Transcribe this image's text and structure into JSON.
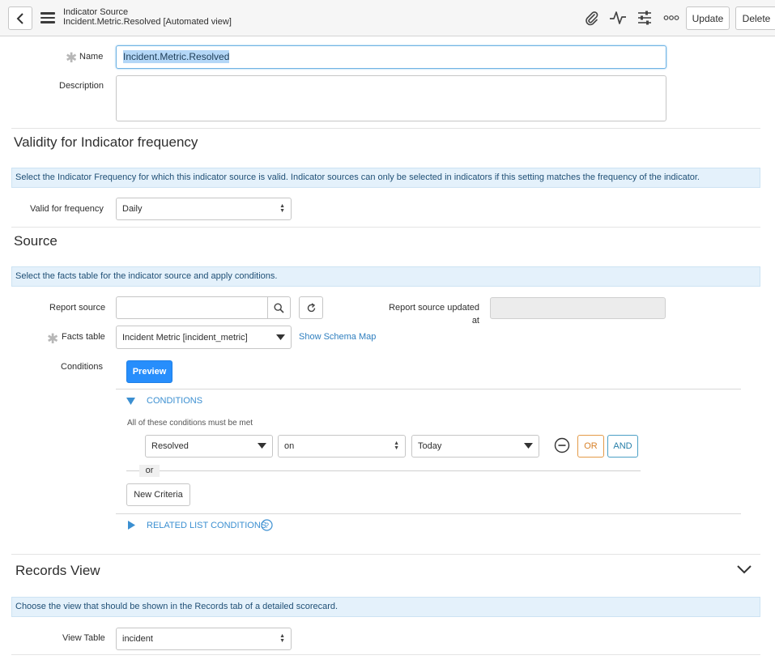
{
  "header": {
    "record_type": "Indicator Source",
    "record_name": "Incident.Metric.Resolved [Automated view]",
    "update_label": "Update",
    "delete_label": "Delete"
  },
  "form": {
    "name_label": "Name",
    "name_value": "Incident.Metric.Resolved",
    "description_label": "Description",
    "description_value": ""
  },
  "validity": {
    "title": "Validity for Indicator frequency",
    "info": "Select the Indicator Frequency for which this indicator source is valid. Indicator sources can only be selected in indicators if this setting matches the frequency of the indicator.",
    "frequency_label": "Valid for frequency",
    "frequency_value": "Daily"
  },
  "source": {
    "title": "Source",
    "info": "Select the facts table for the indicator source and apply conditions.",
    "report_source_label": "Report source",
    "report_source_value": "",
    "report_updated_label_line1": "Report source updated",
    "report_updated_label_line2": "at",
    "facts_label": "Facts table",
    "facts_value": "Incident Metric [incident_metric]",
    "schema_link": "Show Schema Map",
    "conditions_label": "Conditions",
    "preview_label": "Preview",
    "conditions_header": "CONDITIONS",
    "conditions_note": "All of these conditions must be met",
    "condition": {
      "field": "Resolved",
      "operator": "on",
      "value": "Today"
    },
    "or_label": "OR",
    "and_label": "AND",
    "or_divider": "or",
    "new_criteria_label": "New Criteria",
    "related_header": "RELATED LIST CONDITIONS"
  },
  "records_view": {
    "title": "Records View",
    "info": "Choose the view that should be shown in the Records tab of a detailed scorecard.",
    "view_table_label": "View Table",
    "view_table_value": "incident"
  }
}
